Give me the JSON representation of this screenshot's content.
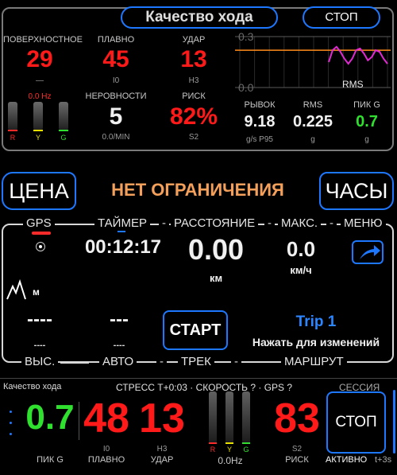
{
  "header": {
    "title": "Качество хода",
    "stop_label": "СТОП"
  },
  "metrics": {
    "surface": {
      "label": "ПОВЕРХНОСТНОЕ",
      "value": "29",
      "sub": "—",
      "hz": "0.0 Hz"
    },
    "smooth": {
      "label": "ПЛАВНО",
      "value": "45",
      "sub": "I0"
    },
    "impact": {
      "label": "УДАР",
      "value": "13",
      "sub": "H3"
    },
    "roughness": {
      "label": "НЕРОВНОСТИ",
      "value": "5",
      "sub": "0.0/MIN"
    },
    "risk": {
      "label": "РИСК",
      "value": "82%",
      "sub": "S2"
    },
    "jerk": {
      "label": "РЫВОК",
      "value": "9.18",
      "sub": "g/s P95"
    },
    "rms": {
      "label": "RMS",
      "value": "0.225",
      "sub": "g"
    },
    "peak": {
      "label": "ПИК G",
      "value": "0.7",
      "sub": "g"
    }
  },
  "ryg": [
    "R",
    "Y",
    "G"
  ],
  "rms_chart": {
    "ymax_label": "0.3",
    "ymin_label": "0.0",
    "series_label": "RMS",
    "chart_data": {
      "type": "line",
      "ylim": [
        0,
        0.3
      ],
      "values": [
        0.15,
        0.22,
        0.24,
        0.21,
        0.17,
        0.14,
        0.17,
        0.22,
        0.23,
        0.2,
        0.16,
        0.18,
        0.22,
        0.21,
        0.17,
        0.14
      ],
      "threshold": 0.22
    }
  },
  "nav": {
    "price": "ЦЕНА",
    "status": "НЕТ ОГРАНИЧЕНИЯ",
    "clock": "ЧАСЫ"
  },
  "tabs": {
    "gps": "GPS",
    "timer": "ТАЙМЕР",
    "distance": "РАССТОЯНИЕ",
    "max": "МАКС.",
    "menu": "МЕНЮ"
  },
  "stats": {
    "timer": "00:12:17",
    "distance": "0.00",
    "distance_unit": "км",
    "max": "0.0",
    "max_unit": "км/ч",
    "alt_unit": "м",
    "alt_value": "----",
    "alt_sub": "----",
    "auto_value": "---",
    "auto_sub": "----",
    "start": "СТАРТ",
    "trip": "Trip 1",
    "trip_hint": "Нажать для изменений"
  },
  "bottom_tabs": {
    "alt": "ВЫС.",
    "auto": "АВТО",
    "track": "ТРЕК",
    "route": "МАРШРУТ"
  },
  "footer": {
    "title": "Качество хода",
    "status": "СТРЕСС T+0:03 · СКОРОСТЬ ? · GPS ?",
    "session": "СЕССИЯ",
    "peak": {
      "value": "0.7",
      "label": "ПИК G"
    },
    "smooth": {
      "value": "48",
      "sub": "I0",
      "label": "ПЛАВНО"
    },
    "impact": {
      "value": "13",
      "sub": "H3",
      "label": "УДАР"
    },
    "hz": "0.0Hz",
    "risk": {
      "value": "83",
      "sub": "S2",
      "label": "РИСК"
    },
    "stop": "СТОП",
    "active": "АКТИВНО",
    "elapsed": "t+3s"
  }
}
